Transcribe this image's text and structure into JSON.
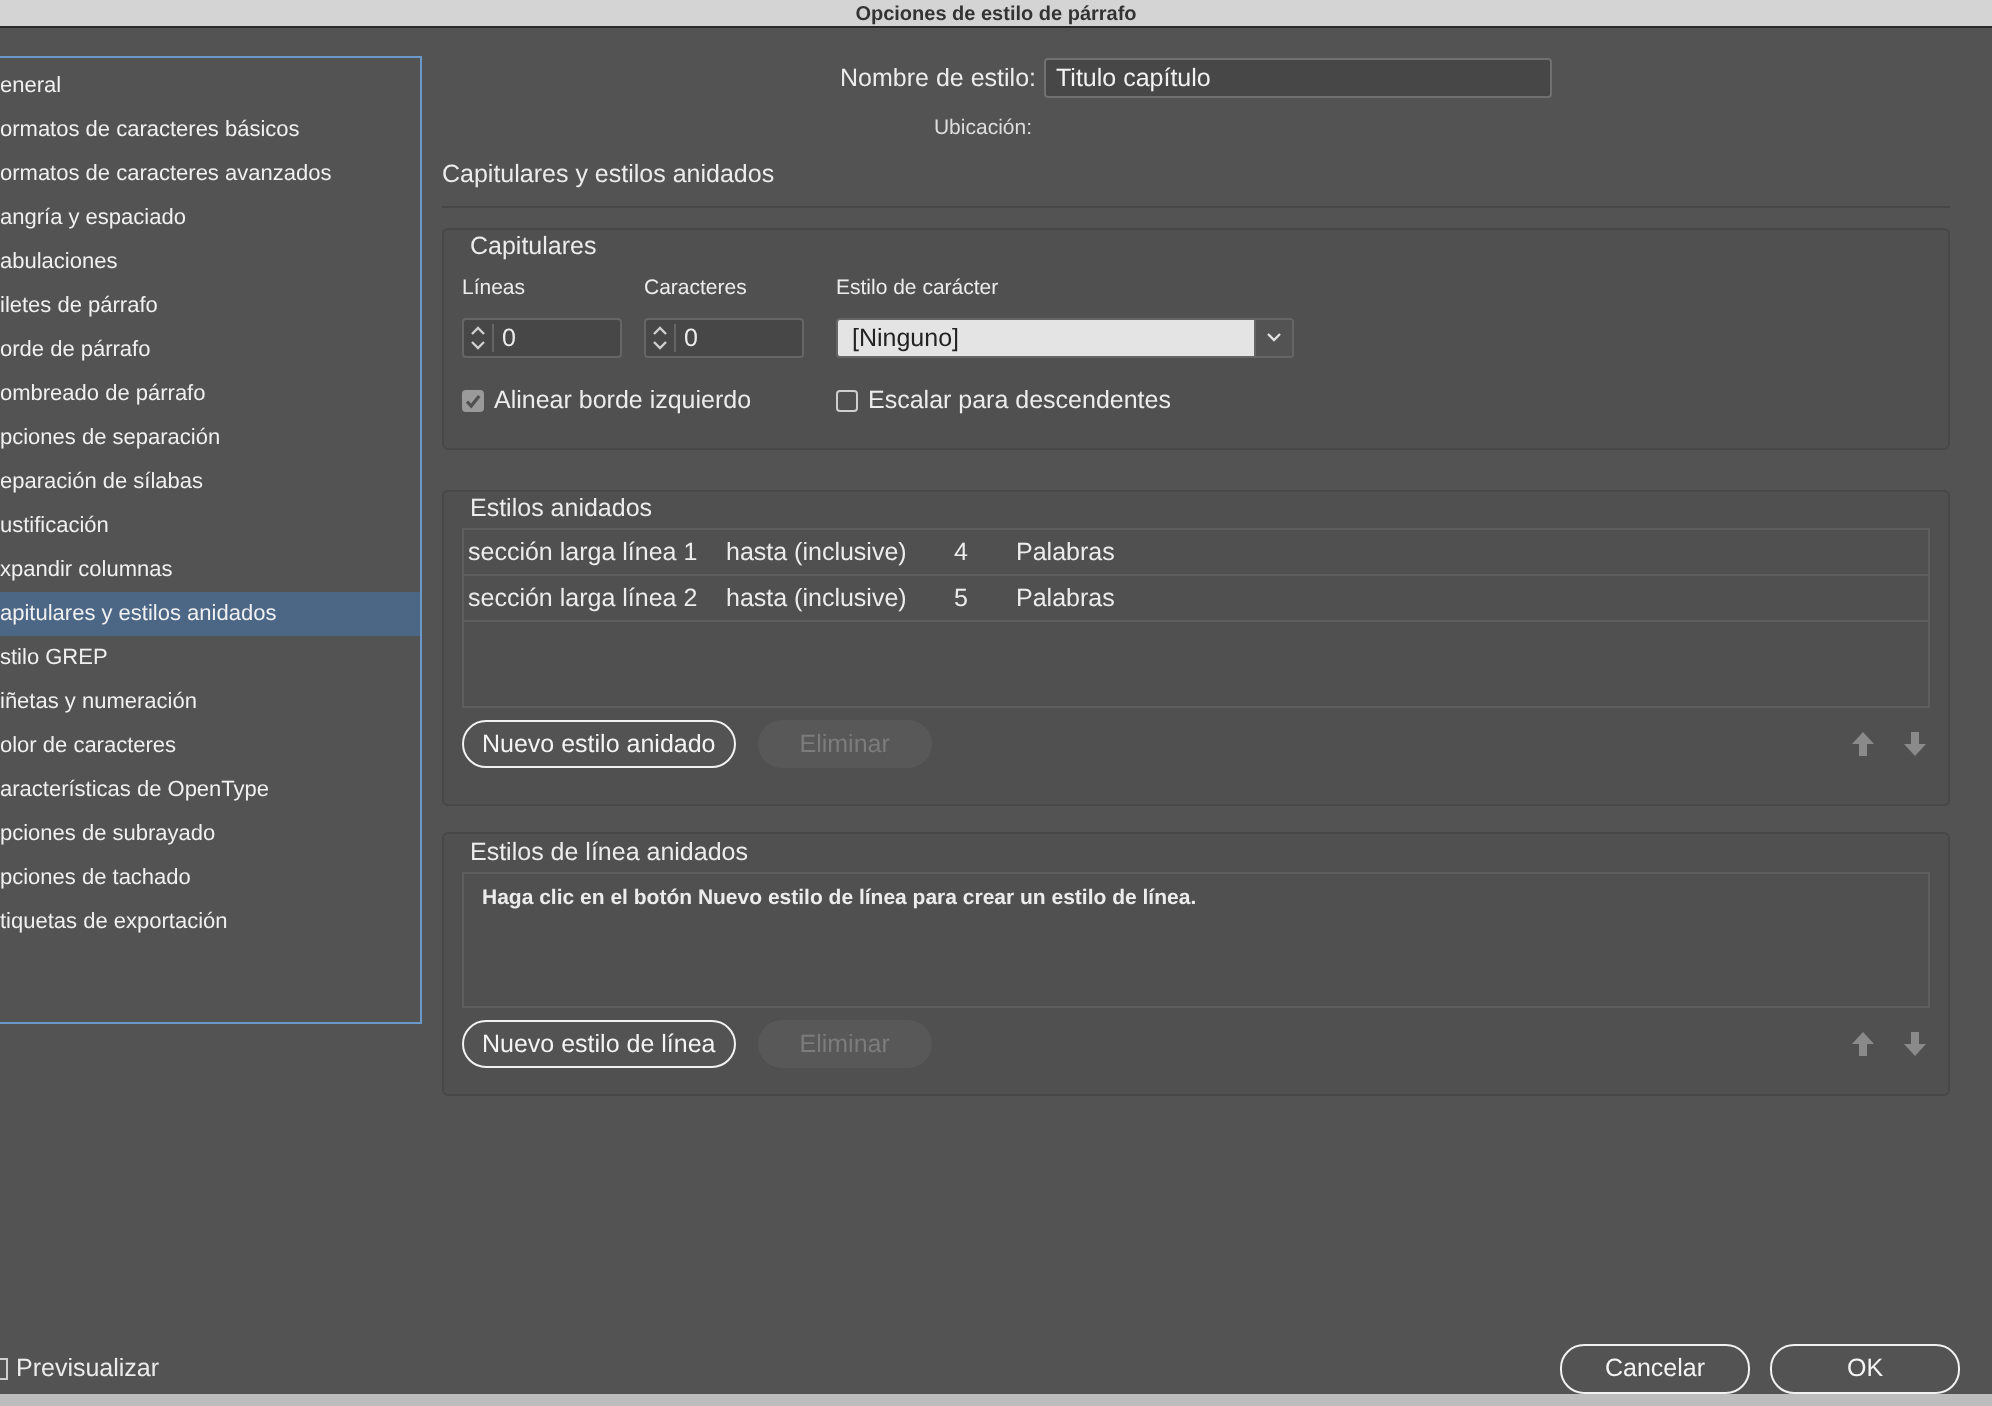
{
  "window": {
    "title": "Opciones de estilo de párrafo"
  },
  "sidebar": {
    "items": [
      {
        "label": "eneral",
        "selected": false
      },
      {
        "label": "ormatos de caracteres básicos",
        "selected": false
      },
      {
        "label": "ormatos de caracteres avanzados",
        "selected": false
      },
      {
        "label": "angría y espaciado",
        "selected": false
      },
      {
        "label": "abulaciones",
        "selected": false
      },
      {
        "label": "iletes de párrafo",
        "selected": false
      },
      {
        "label": "orde de párrafo",
        "selected": false
      },
      {
        "label": "ombreado de párrafo",
        "selected": false
      },
      {
        "label": "pciones de separación",
        "selected": false
      },
      {
        "label": "eparación de sílabas",
        "selected": false
      },
      {
        "label": "ustificación",
        "selected": false
      },
      {
        "label": "xpandir columnas",
        "selected": false
      },
      {
        "label": "apitulares y estilos anidados",
        "selected": true
      },
      {
        "label": "stilo GREP",
        "selected": false
      },
      {
        "label": "iñetas y numeración",
        "selected": false
      },
      {
        "label": "olor de caracteres",
        "selected": false
      },
      {
        "label": "aracterísticas de OpenType",
        "selected": false
      },
      {
        "label": "pciones de subrayado",
        "selected": false
      },
      {
        "label": "pciones de tachado",
        "selected": false
      },
      {
        "label": "tiquetas de exportación",
        "selected": false
      }
    ]
  },
  "style_name": {
    "label": "Nombre de estilo:",
    "value": "Titulo capítulo"
  },
  "location": {
    "label": "Ubicación:"
  },
  "section_title": "Capitulares y estilos anidados",
  "drop_caps": {
    "title": "Capitulares",
    "fields": [
      {
        "label": "Líneas",
        "value": "0"
      },
      {
        "label": "Caracteres",
        "value": "0"
      }
    ],
    "character_style": {
      "label": "Estilo de carácter",
      "value": "[Ninguno]"
    },
    "checkboxes": [
      {
        "label": "Alinear borde izquierdo",
        "checked": true
      },
      {
        "label": "Escalar para descendentes",
        "checked": false
      }
    ]
  },
  "nested_styles": {
    "title": "Estilos anidados",
    "rows": [
      {
        "cells": [
          "sección larga línea 1",
          "hasta (inclusive)",
          "4",
          "Palabras"
        ]
      },
      {
        "cells": [
          "sección larga línea 2",
          "hasta (inclusive)",
          "5",
          "Palabras"
        ]
      }
    ],
    "buttons": [
      {
        "label": "Nuevo estilo anidado",
        "disabled": false
      },
      {
        "label": "Eliminar",
        "disabled": true
      }
    ]
  },
  "nested_line_styles": {
    "title": "Estilos de línea anidados",
    "message": "Haga clic en el botón Nuevo estilo de línea para crear un estilo de línea.",
    "buttons": [
      {
        "label": "Nuevo estilo de línea",
        "disabled": false
      },
      {
        "label": "Eliminar",
        "disabled": true
      }
    ]
  },
  "preview": {
    "label": "Previsualizar",
    "checked": false
  },
  "buttons": [
    {
      "label": "Cancelar"
    },
    {
      "label": "OK"
    }
  ]
}
